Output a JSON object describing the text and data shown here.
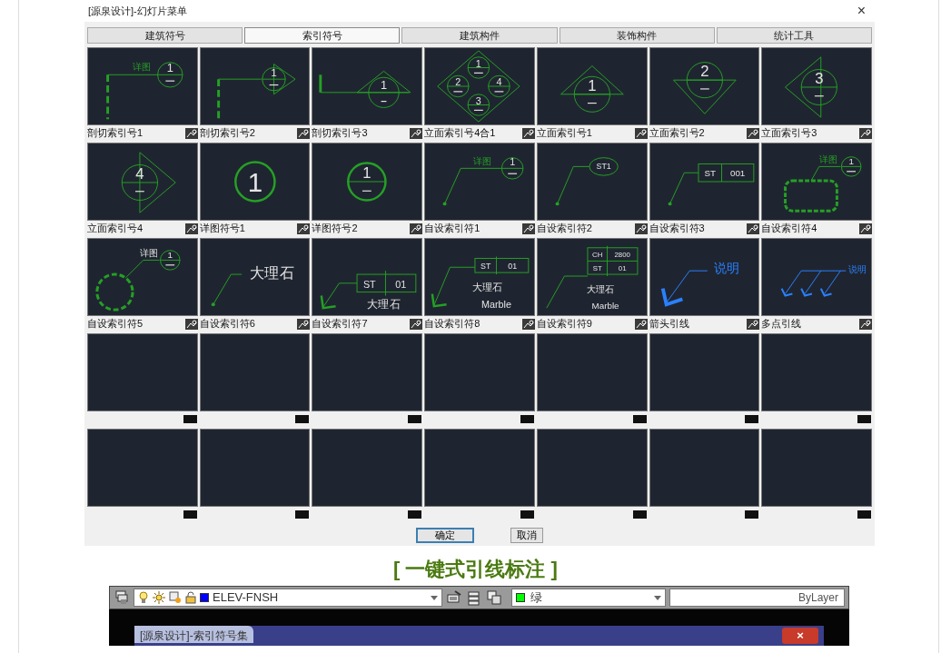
{
  "dialog": {
    "title": "[源泉设计]-幻灯片菜单",
    "close": "×",
    "tabs": [
      {
        "label": "建筑符号",
        "selected": false
      },
      {
        "label": "索引符号",
        "selected": true
      },
      {
        "label": "建筑构件",
        "selected": false
      },
      {
        "label": "装饰构件",
        "selected": false
      },
      {
        "label": "统计工具",
        "selected": false
      }
    ],
    "slides": [
      {
        "kind": "cut-circle",
        "label": "剖切索引号1",
        "texts": [
          "详图",
          "1"
        ]
      },
      {
        "kind": "cut-arrow",
        "label": "剖切索引号2",
        "texts": [
          "1"
        ]
      },
      {
        "kind": "cut-triangle",
        "label": "剖切索引号3",
        "texts": [
          "1"
        ]
      },
      {
        "kind": "elev-four",
        "label": "立面索引号4合1",
        "texts": [
          "1",
          "2",
          "4",
          "3"
        ]
      },
      {
        "kind": "elev-up",
        "label": "立面索引号1",
        "texts": [
          "1"
        ]
      },
      {
        "kind": "elev-down",
        "label": "立面索引号2",
        "texts": [
          "2"
        ]
      },
      {
        "kind": "elev-left",
        "label": "立面索引号3",
        "texts": [
          "3"
        ]
      },
      {
        "kind": "elev-right",
        "label": "立面索引号4",
        "texts": [
          "4"
        ]
      },
      {
        "kind": "detail",
        "label": "详图符号1",
        "texts": [
          "1"
        ]
      },
      {
        "kind": "detail-split",
        "label": "详图符号2",
        "texts": [
          "1"
        ]
      },
      {
        "kind": "leader-circle",
        "label": "自设索引符1",
        "texts": [
          "详图",
          "1"
        ]
      },
      {
        "kind": "leader-ellipse",
        "label": "自设索引符2",
        "texts": [
          "ST1"
        ]
      },
      {
        "kind": "leader-box",
        "label": "自设索引符3",
        "texts": [
          "ST",
          "001"
        ]
      },
      {
        "kind": "leader-rect-cloud",
        "label": "自设索引符4",
        "texts": [
          "详图",
          "1"
        ]
      },
      {
        "kind": "leader-circle-cloud",
        "label": "自设索引符5",
        "texts": [
          "详图",
          "1"
        ]
      },
      {
        "kind": "leader-text",
        "label": "自设索引符6",
        "texts": [
          "大理石"
        ]
      },
      {
        "kind": "leader-box-text",
        "label": "自设索引符7",
        "texts": [
          "ST",
          "01",
          "大理石"
        ]
      },
      {
        "kind": "leader-box-text2",
        "label": "自设索引符8",
        "texts": [
          "ST",
          "01",
          "大理石",
          "Marble"
        ]
      },
      {
        "kind": "leader-table",
        "label": "自设索引符9",
        "texts": [
          "CH",
          "2800",
          "ST",
          "01",
          "大理石",
          "Marble"
        ]
      },
      {
        "kind": "arrow-leader",
        "label": "箭头引线",
        "texts": [
          "说明"
        ]
      },
      {
        "kind": "multi-leader",
        "label": "多点引线",
        "texts": [
          "说明"
        ]
      },
      {
        "kind": "empty"
      },
      {
        "kind": "empty"
      },
      {
        "kind": "empty"
      },
      {
        "kind": "empty"
      },
      {
        "kind": "empty"
      },
      {
        "kind": "empty"
      },
      {
        "kind": "empty"
      },
      {
        "kind": "empty"
      },
      {
        "kind": "empty"
      },
      {
        "kind": "empty"
      },
      {
        "kind": "empty"
      },
      {
        "kind": "empty"
      },
      {
        "kind": "empty"
      },
      {
        "kind": "empty"
      }
    ],
    "buttons": [
      {
        "label": "确定",
        "selected": true
      },
      {
        "label": "取消",
        "selected": false
      }
    ]
  },
  "heading": "[ 一键式引线标注 ]",
  "toolbar": {
    "layer": "ELEV-FNSH",
    "color_name": "绿",
    "linetype": "ByLayer"
  },
  "window": {
    "title": "[源泉设计]-索引符号集",
    "close": "×"
  }
}
